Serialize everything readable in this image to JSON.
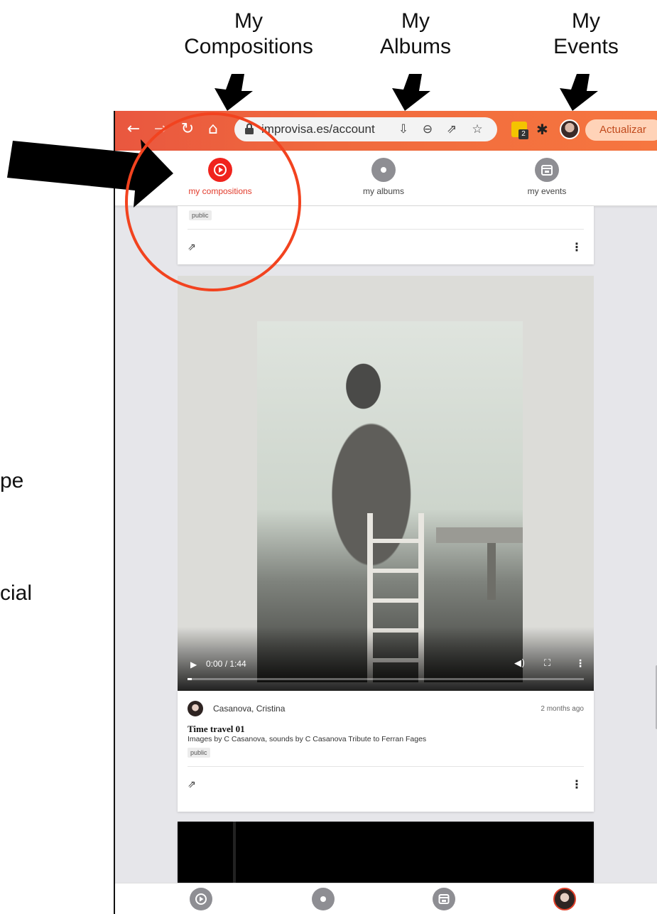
{
  "annotations": {
    "my_compositions": "My Compositions",
    "my_albums": "My Albums",
    "my_events": "My Events",
    "cut_text_1": "pe",
    "cut_text_2": "cial"
  },
  "browser": {
    "url": "improvisa.es/account",
    "extension_badge_count": "2",
    "update_button": "Actualizar"
  },
  "topnav": {
    "items": [
      {
        "label": "my compositions",
        "active": true
      },
      {
        "label": "my albums",
        "active": false
      },
      {
        "label": "my events",
        "active": false
      }
    ]
  },
  "cards": [
    {
      "tag": "public"
    },
    {
      "author": "Casanova, Cristina",
      "time_ago": "2 months ago",
      "title": "Time travel 01",
      "description": "Images by C Casanova, sounds by C Casanova Tribute to Ferran Fages",
      "tag": "public",
      "video": {
        "time": "0:00 / 1:44",
        "progress": 0.01
      }
    }
  ],
  "colors": {
    "accent_red": "#f0231d",
    "annotation_circle": "#f2431f",
    "toolbar_orange": "#f06a3e"
  }
}
